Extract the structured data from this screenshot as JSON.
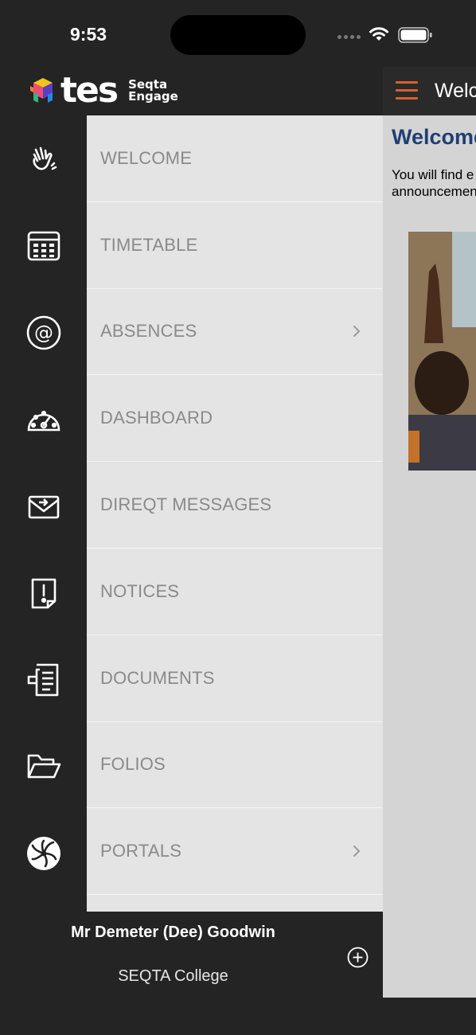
{
  "status_bar": {
    "time": "9:53"
  },
  "brand": {
    "name": "tes",
    "subtitle_line1": "Seqta",
    "subtitle_line2": "Engage",
    "icon": "tes-logo-cubes"
  },
  "header": {
    "title": "Welc",
    "menu_icon": "hamburger-icon",
    "accent_color": "#d6612b"
  },
  "page": {
    "title": "Welcome",
    "text_line1": "You will find e",
    "text_line2": "announcemen"
  },
  "menu": {
    "items": [
      {
        "label": "WELCOME",
        "icon": "waving-hand-icon",
        "has_chevron": false
      },
      {
        "label": "TIMETABLE",
        "icon": "timetable-grid-icon",
        "has_chevron": false
      },
      {
        "label": "ABSENCES",
        "icon": "at-sign-icon",
        "has_chevron": true
      },
      {
        "label": "DASHBOARD",
        "icon": "gauge-icon",
        "has_chevron": false
      },
      {
        "label": "DIREQT MESSAGES",
        "icon": "envelope-arrow-icon",
        "has_chevron": false
      },
      {
        "label": "NOTICES",
        "icon": "notice-exclamation-icon",
        "has_chevron": false
      },
      {
        "label": "DOCUMENTS",
        "icon": "document-icon",
        "has_chevron": false
      },
      {
        "label": "FOLIOS",
        "icon": "folder-open-icon",
        "has_chevron": false
      },
      {
        "label": "PORTALS",
        "icon": "portal-swirl-icon",
        "has_chevron": true
      }
    ]
  },
  "user": {
    "name": "Mr Demeter (Dee) Goodwin",
    "school": "SEQTA College",
    "add_icon": "plus-circle-icon"
  },
  "colors": {
    "drawer_bg": "#242424",
    "menu_bg": "#e4e4e4",
    "menu_text": "#8a8a8a",
    "title_blue": "#1f3f73"
  }
}
